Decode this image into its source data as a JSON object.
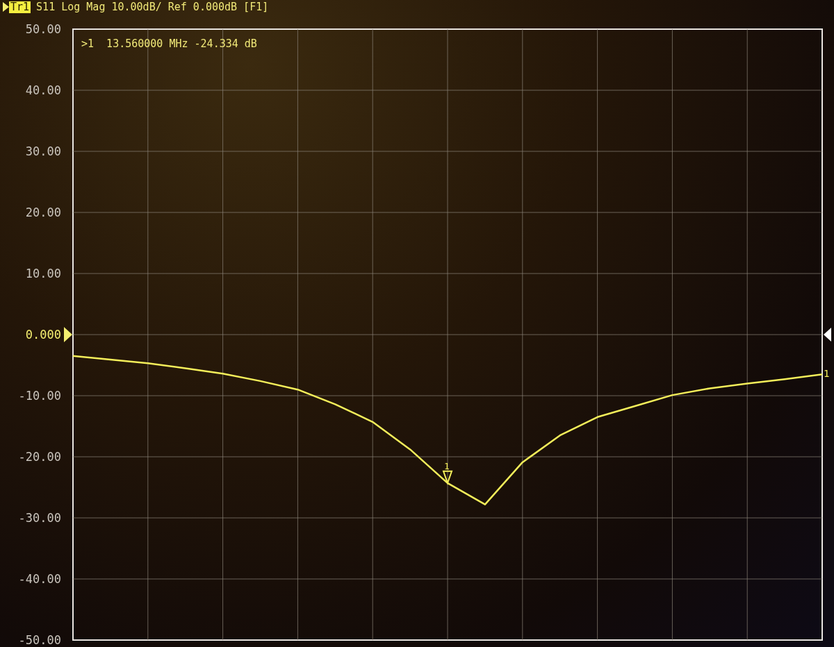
{
  "trace_header": {
    "trace": "Tr1",
    "text": "S11 Log Mag 10.00dB/ Ref 0.000dB [F1]"
  },
  "marker": {
    "readout": ">1  13.560000 MHz -24.334 dB",
    "label": "1",
    "trace_end_label": "1"
  },
  "chart_data": {
    "type": "line",
    "grid": true,
    "ylim": [
      -50,
      50
    ],
    "yticks": [
      {
        "value": 50,
        "label": "50.00"
      },
      {
        "value": 40,
        "label": "40.00"
      },
      {
        "value": 30,
        "label": "30.00"
      },
      {
        "value": 20,
        "label": "20.00"
      },
      {
        "value": 10,
        "label": "10.00"
      },
      {
        "value": 0,
        "label": "0.000"
      },
      {
        "value": -10,
        "label": "-10.00"
      },
      {
        "value": -20,
        "label": "-20.00"
      },
      {
        "value": -30,
        "label": "-30.00"
      },
      {
        "value": -40,
        "label": "-40.00"
      },
      {
        "value": -50,
        "label": "-50.00"
      }
    ],
    "categories": [
      null,
      null,
      null,
      null,
      null,
      null,
      null,
      null,
      null,
      null,
      null,
      null,
      null,
      null,
      null,
      null,
      null,
      null,
      null,
      null,
      null
    ],
    "series": [
      {
        "color": "#f4ee5a",
        "values": [
          -3.5,
          -4.1,
          -4.7,
          -5.5,
          -6.4,
          -7.6,
          -9,
          -11.4,
          -14.3,
          -18.8,
          -24.3,
          -27.8,
          -20.9,
          -16.5,
          -13.5,
          -11.7,
          -9.9,
          -8.8,
          -8,
          -7.3,
          -6.5
        ]
      }
    ]
  }
}
